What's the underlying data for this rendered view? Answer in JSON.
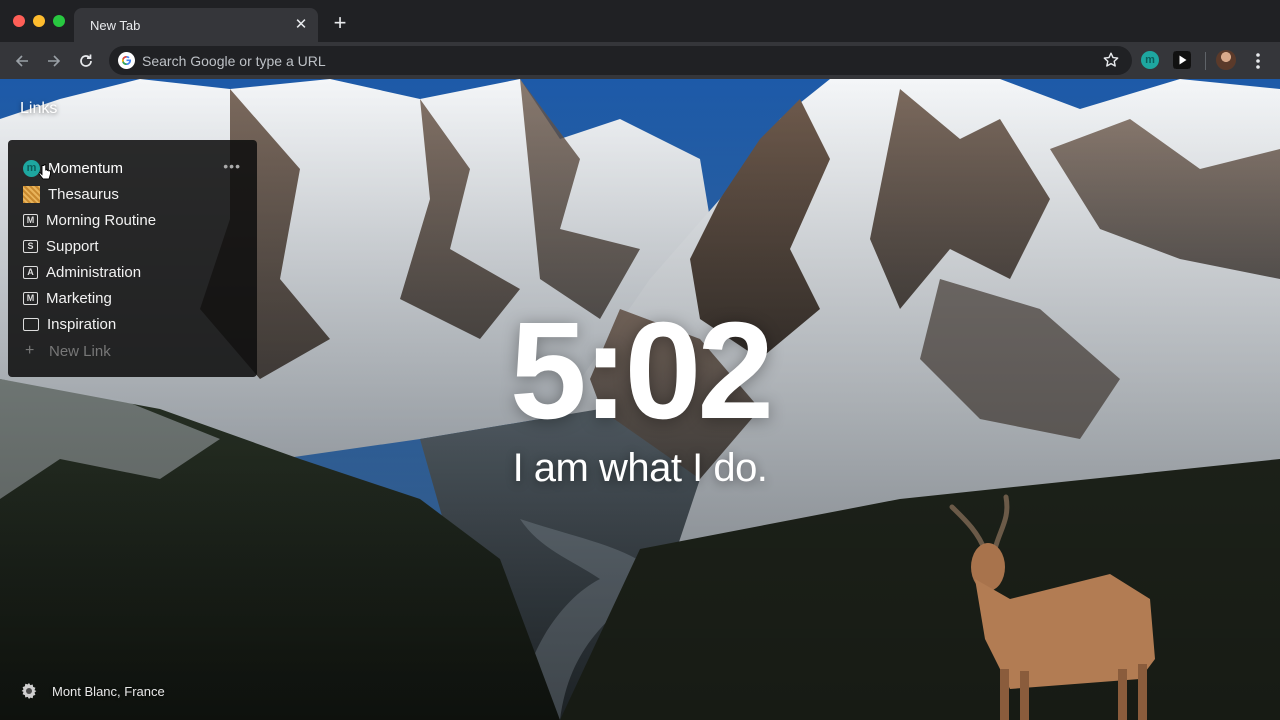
{
  "tab": {
    "title": "New Tab",
    "close_glyph": "✕"
  },
  "toolbar": {
    "new_tab_glyph": "+",
    "omnibox_placeholder": "Search Google or type a URL",
    "extension_letter": "m",
    "icons": [
      "back-arrow-icon",
      "forward-arrow-icon",
      "reload-icon",
      "google-icon",
      "star-icon",
      "momentum-extension-icon",
      "play-extension-icon",
      "profile-avatar",
      "kebab-menu-icon"
    ]
  },
  "links": {
    "title": "Links",
    "items": [
      {
        "label": "Momentum",
        "icon": "momentum-icon",
        "icon_text": "m"
      },
      {
        "label": "Thesaurus",
        "icon": "thesaurus-icon",
        "icon_text": ""
      },
      {
        "label": "Morning Routine",
        "icon": "letter-m-icon",
        "icon_text": "M"
      },
      {
        "label": "Support",
        "icon": "letter-s-icon",
        "icon_text": "S"
      },
      {
        "label": "Administration",
        "icon": "letter-a-icon",
        "icon_text": "A"
      },
      {
        "label": "Marketing",
        "icon": "letter-m-icon",
        "icon_text": "M"
      },
      {
        "label": "Inspiration",
        "icon": "folder-icon",
        "icon_text": ""
      }
    ],
    "more_glyph": "•••",
    "new_link_glyph": "+",
    "new_link_label": "New Link"
  },
  "clock": {
    "time": "5:02"
  },
  "mantra": {
    "text": "I am what I do."
  },
  "footer": {
    "location": "Mont Blanc, France"
  },
  "colors": {
    "accent": "#1ea7a0",
    "chrome_dark": "#202124",
    "chrome_toolbar": "#35363a"
  }
}
